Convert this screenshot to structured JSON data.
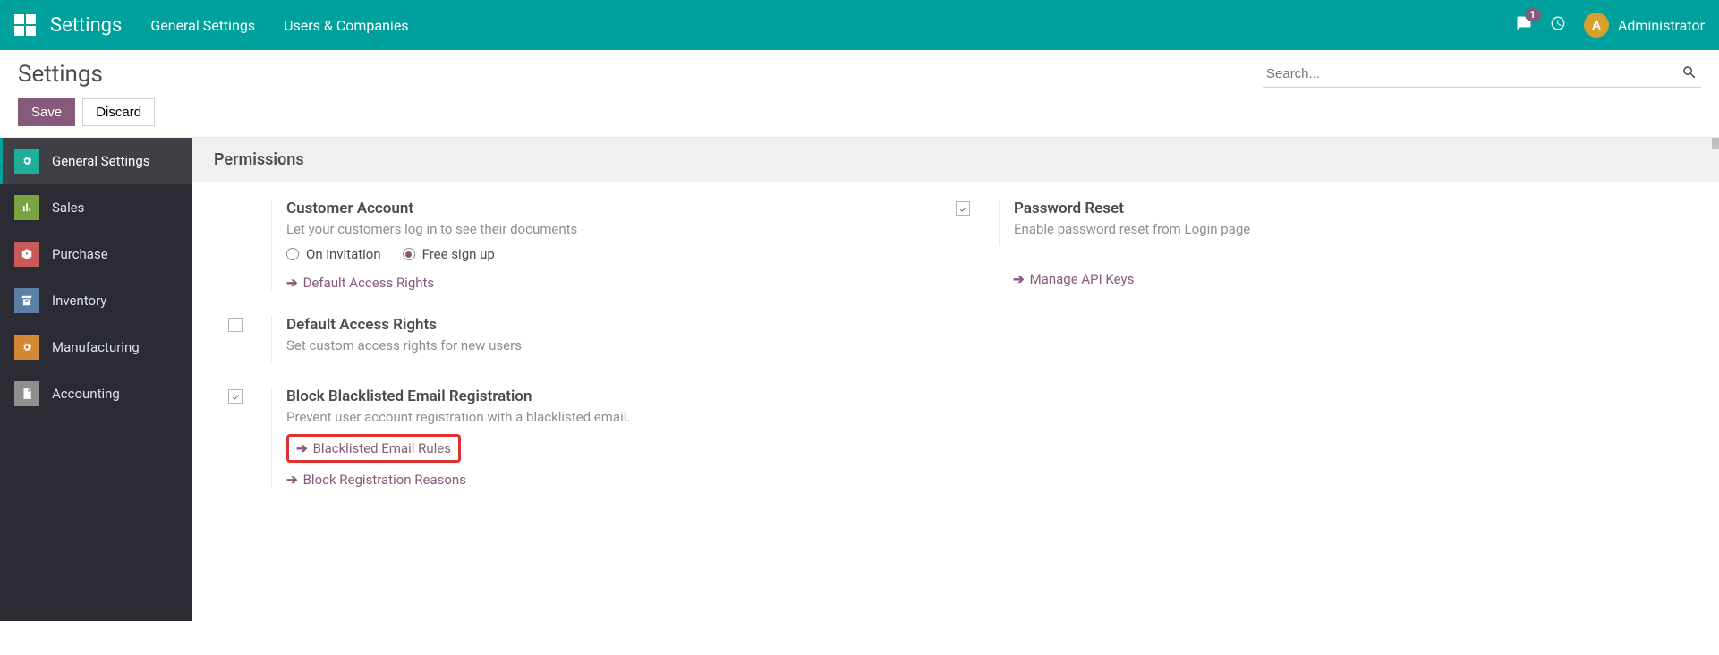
{
  "navbar": {
    "title": "Settings",
    "menu": [
      "General Settings",
      "Users & Companies"
    ],
    "messages_badge": "1",
    "user_initial": "A",
    "user_name": "Administrator"
  },
  "control_panel": {
    "title": "Settings",
    "search_placeholder": "Search...",
    "save": "Save",
    "discard": "Discard"
  },
  "sidebar": {
    "items": [
      {
        "label": "General Settings",
        "active": true
      },
      {
        "label": "Sales",
        "active": false
      },
      {
        "label": "Purchase",
        "active": false
      },
      {
        "label": "Inventory",
        "active": false
      },
      {
        "label": "Manufacturing",
        "active": false
      },
      {
        "label": "Accounting",
        "active": false
      }
    ]
  },
  "section": {
    "title": "Permissions"
  },
  "settings": {
    "customer_account": {
      "title": "Customer Account",
      "desc": "Let your customers log in to see their documents",
      "radio_invitation": "On invitation",
      "radio_free": "Free sign up",
      "link": "Default Access Rights"
    },
    "password_reset": {
      "title": "Password Reset",
      "desc": "Enable password reset from Login page"
    },
    "default_access": {
      "title": "Default Access Rights",
      "desc": "Set custom access rights for new users"
    },
    "api_keys": {
      "link": "Manage API Keys"
    },
    "blacklist": {
      "title": "Block Blacklisted Email Registration",
      "desc": "Prevent user account registration with a blacklisted email.",
      "link1": "Blacklisted Email Rules",
      "link2": "Block Registration Reasons"
    }
  }
}
